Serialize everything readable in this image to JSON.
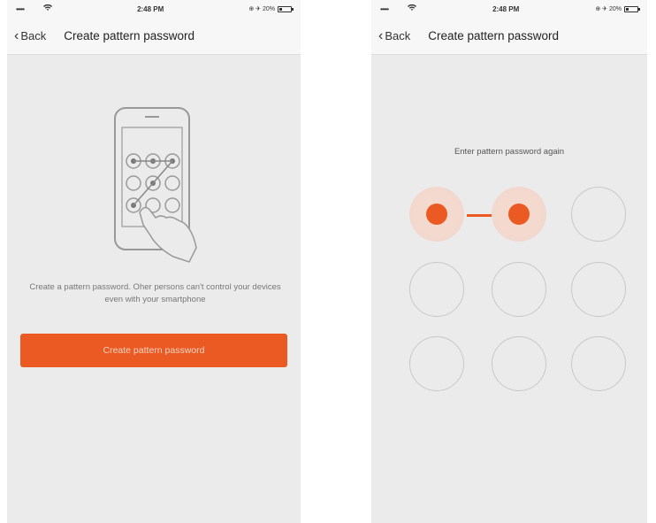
{
  "status_bar": {
    "signal": "•••••",
    "time": "2:48 PM",
    "right_text": "⊕ ✈ 20%"
  },
  "nav": {
    "back_label": "Back",
    "title": "Create pattern password"
  },
  "left_screen": {
    "description": "Create a pattern password. Oher persons can't control your devices even with your smartphone",
    "button_label": "Create pattern password"
  },
  "right_screen": {
    "prompt": "Enter pattern password again",
    "pattern_selected": [
      1,
      2
    ]
  },
  "colors": {
    "accent": "#ea5a22",
    "background": "#ebebeb",
    "nav_background": "#f7f7f7"
  }
}
